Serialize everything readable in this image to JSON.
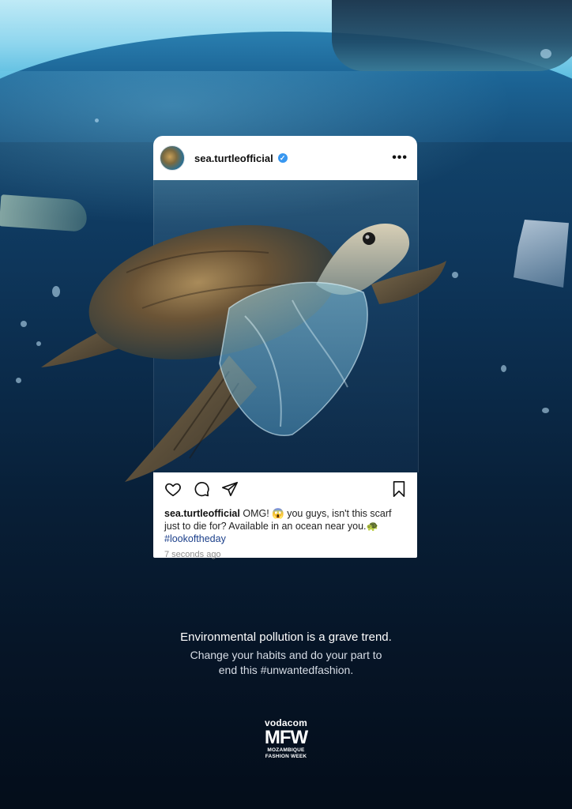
{
  "post": {
    "username": "sea.turtleofficial",
    "verified_mark": "✓",
    "more_glyph": "•••",
    "icons": [
      "heart-icon",
      "comment-icon",
      "share-icon",
      "bookmark-icon"
    ],
    "caption_user": "sea.turtleofficial",
    "caption_text": " OMG! 😱 you guys, isn't this scarf just to die for? Available in an ocean near you.🐢",
    "hashtag": "#lookoftheday",
    "timestamp": "7 seconds ago"
  },
  "message": {
    "headline": "Environmental pollution is a grave trend.",
    "line1": "Change your habits and do your part to",
    "line2": "end this #unwantedfashion."
  },
  "logo": {
    "brand": "vodacom",
    "mark": "MFW",
    "line1": "MOZAMBIQUE",
    "line2": "FASHION WEEK"
  },
  "colors": {
    "verified": "#3897f0",
    "hashtag": "#1b3f8a",
    "ocean_top": "#1a5a86",
    "ocean_bottom": "#040d1a"
  }
}
